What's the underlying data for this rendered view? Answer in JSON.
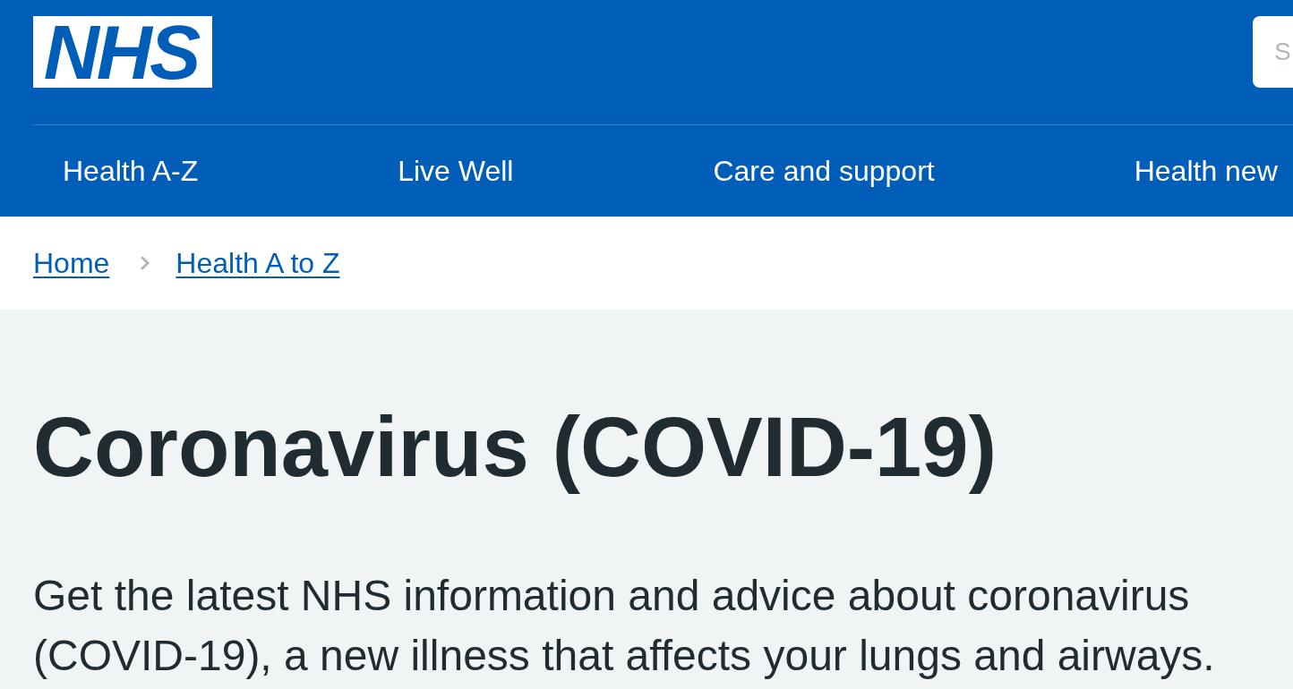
{
  "header": {
    "logo": {
      "text": "NHS"
    },
    "search": {
      "placeholder": "S"
    }
  },
  "nav": {
    "items": [
      {
        "label": "Health A-Z"
      },
      {
        "label": "Live Well"
      },
      {
        "label": "Care and support"
      },
      {
        "label": "Health new"
      }
    ]
  },
  "breadcrumbs": [
    {
      "label": "Home"
    },
    {
      "label": "Health A to Z"
    }
  ],
  "main": {
    "title": "Coronavirus (COVID-19)",
    "intro": "Get the latest NHS information and advice about coronavirus (COVID-19), a new illness that affects your lungs and airways."
  }
}
